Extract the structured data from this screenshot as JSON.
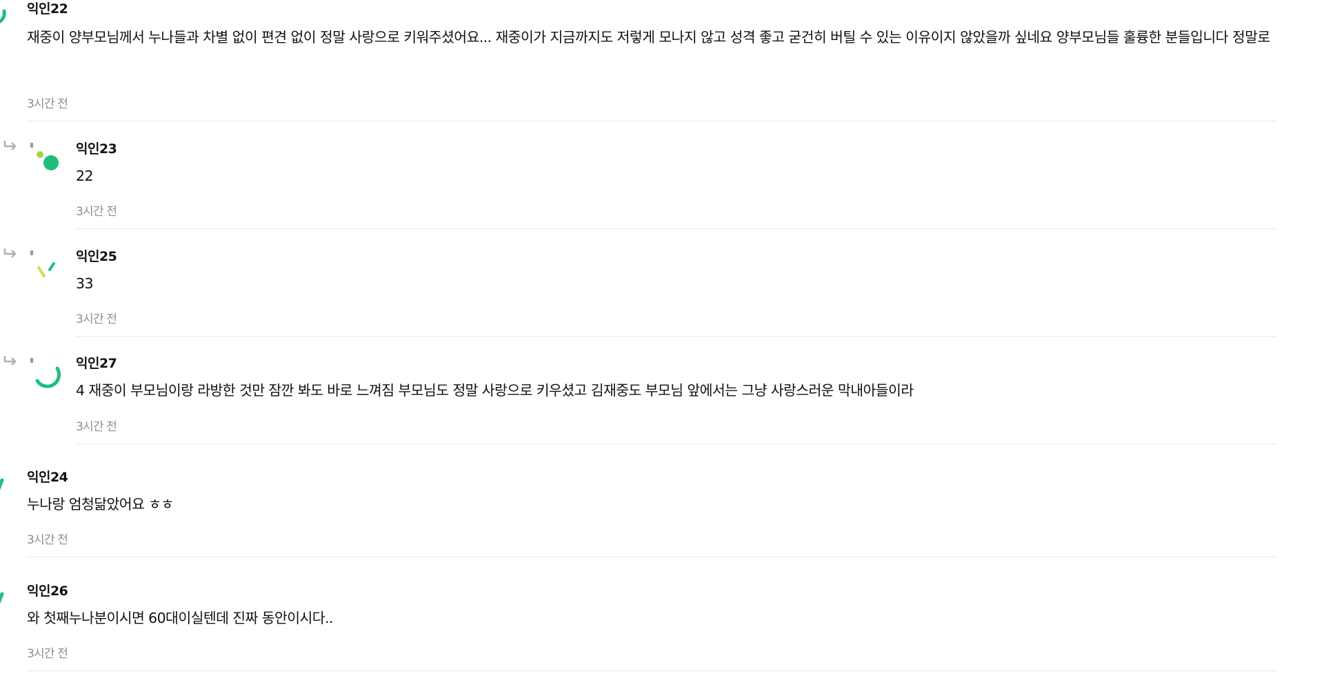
{
  "colors": {
    "accent": "#1fbf7a",
    "lime": "#9fd84a",
    "time": "#8d8d8d",
    "divider": "#e8e8e8"
  },
  "comments": [
    {
      "nick": "익인22",
      "text": "재중이 양부모님께서 누나들과 차별 없이 편견 없이 정말 사랑으로 키워주셨어요... 재중이가 지금까지도 저렇게 모나지 않고 성격 좋고 굳건히 버틸 수 있는 이유이지 않았을까 싶네요 양부모님들 훌륭한 분들입니다 정말로",
      "time": "3시간 전",
      "avatar_icon": "avatar-icon"
    },
    {
      "nick": "익인23",
      "text": "22",
      "time": "3시간 전",
      "avatar_icon": "avatar-icon",
      "reply_icon": "reply-arrow-icon"
    },
    {
      "nick": "익인25",
      "text": "33",
      "time": "3시간 전",
      "avatar_icon": "avatar-icon",
      "reply_icon": "reply-arrow-icon"
    },
    {
      "nick": "익인27",
      "text": "4 재중이 부모님이랑 라방한 것만 잠깐 봐도 바로 느껴짐 부모님도 정말 사랑으로 키우셨고 김재중도 부모님 앞에서는 그냥 사랑스러운 막내아들이라",
      "time": "3시간 전",
      "avatar_icon": "avatar-icon",
      "reply_icon": "reply-arrow-icon"
    },
    {
      "nick": "익인24",
      "text": "누나랑 엄청닮았어요 ㅎㅎ",
      "time": "3시간 전",
      "avatar_icon": "avatar-icon"
    },
    {
      "nick": "익인26",
      "text": "와 첫째누나분이시면 60대이실텐데 진짜 동안이시다..",
      "time": "3시간 전",
      "avatar_icon": "avatar-icon"
    }
  ]
}
